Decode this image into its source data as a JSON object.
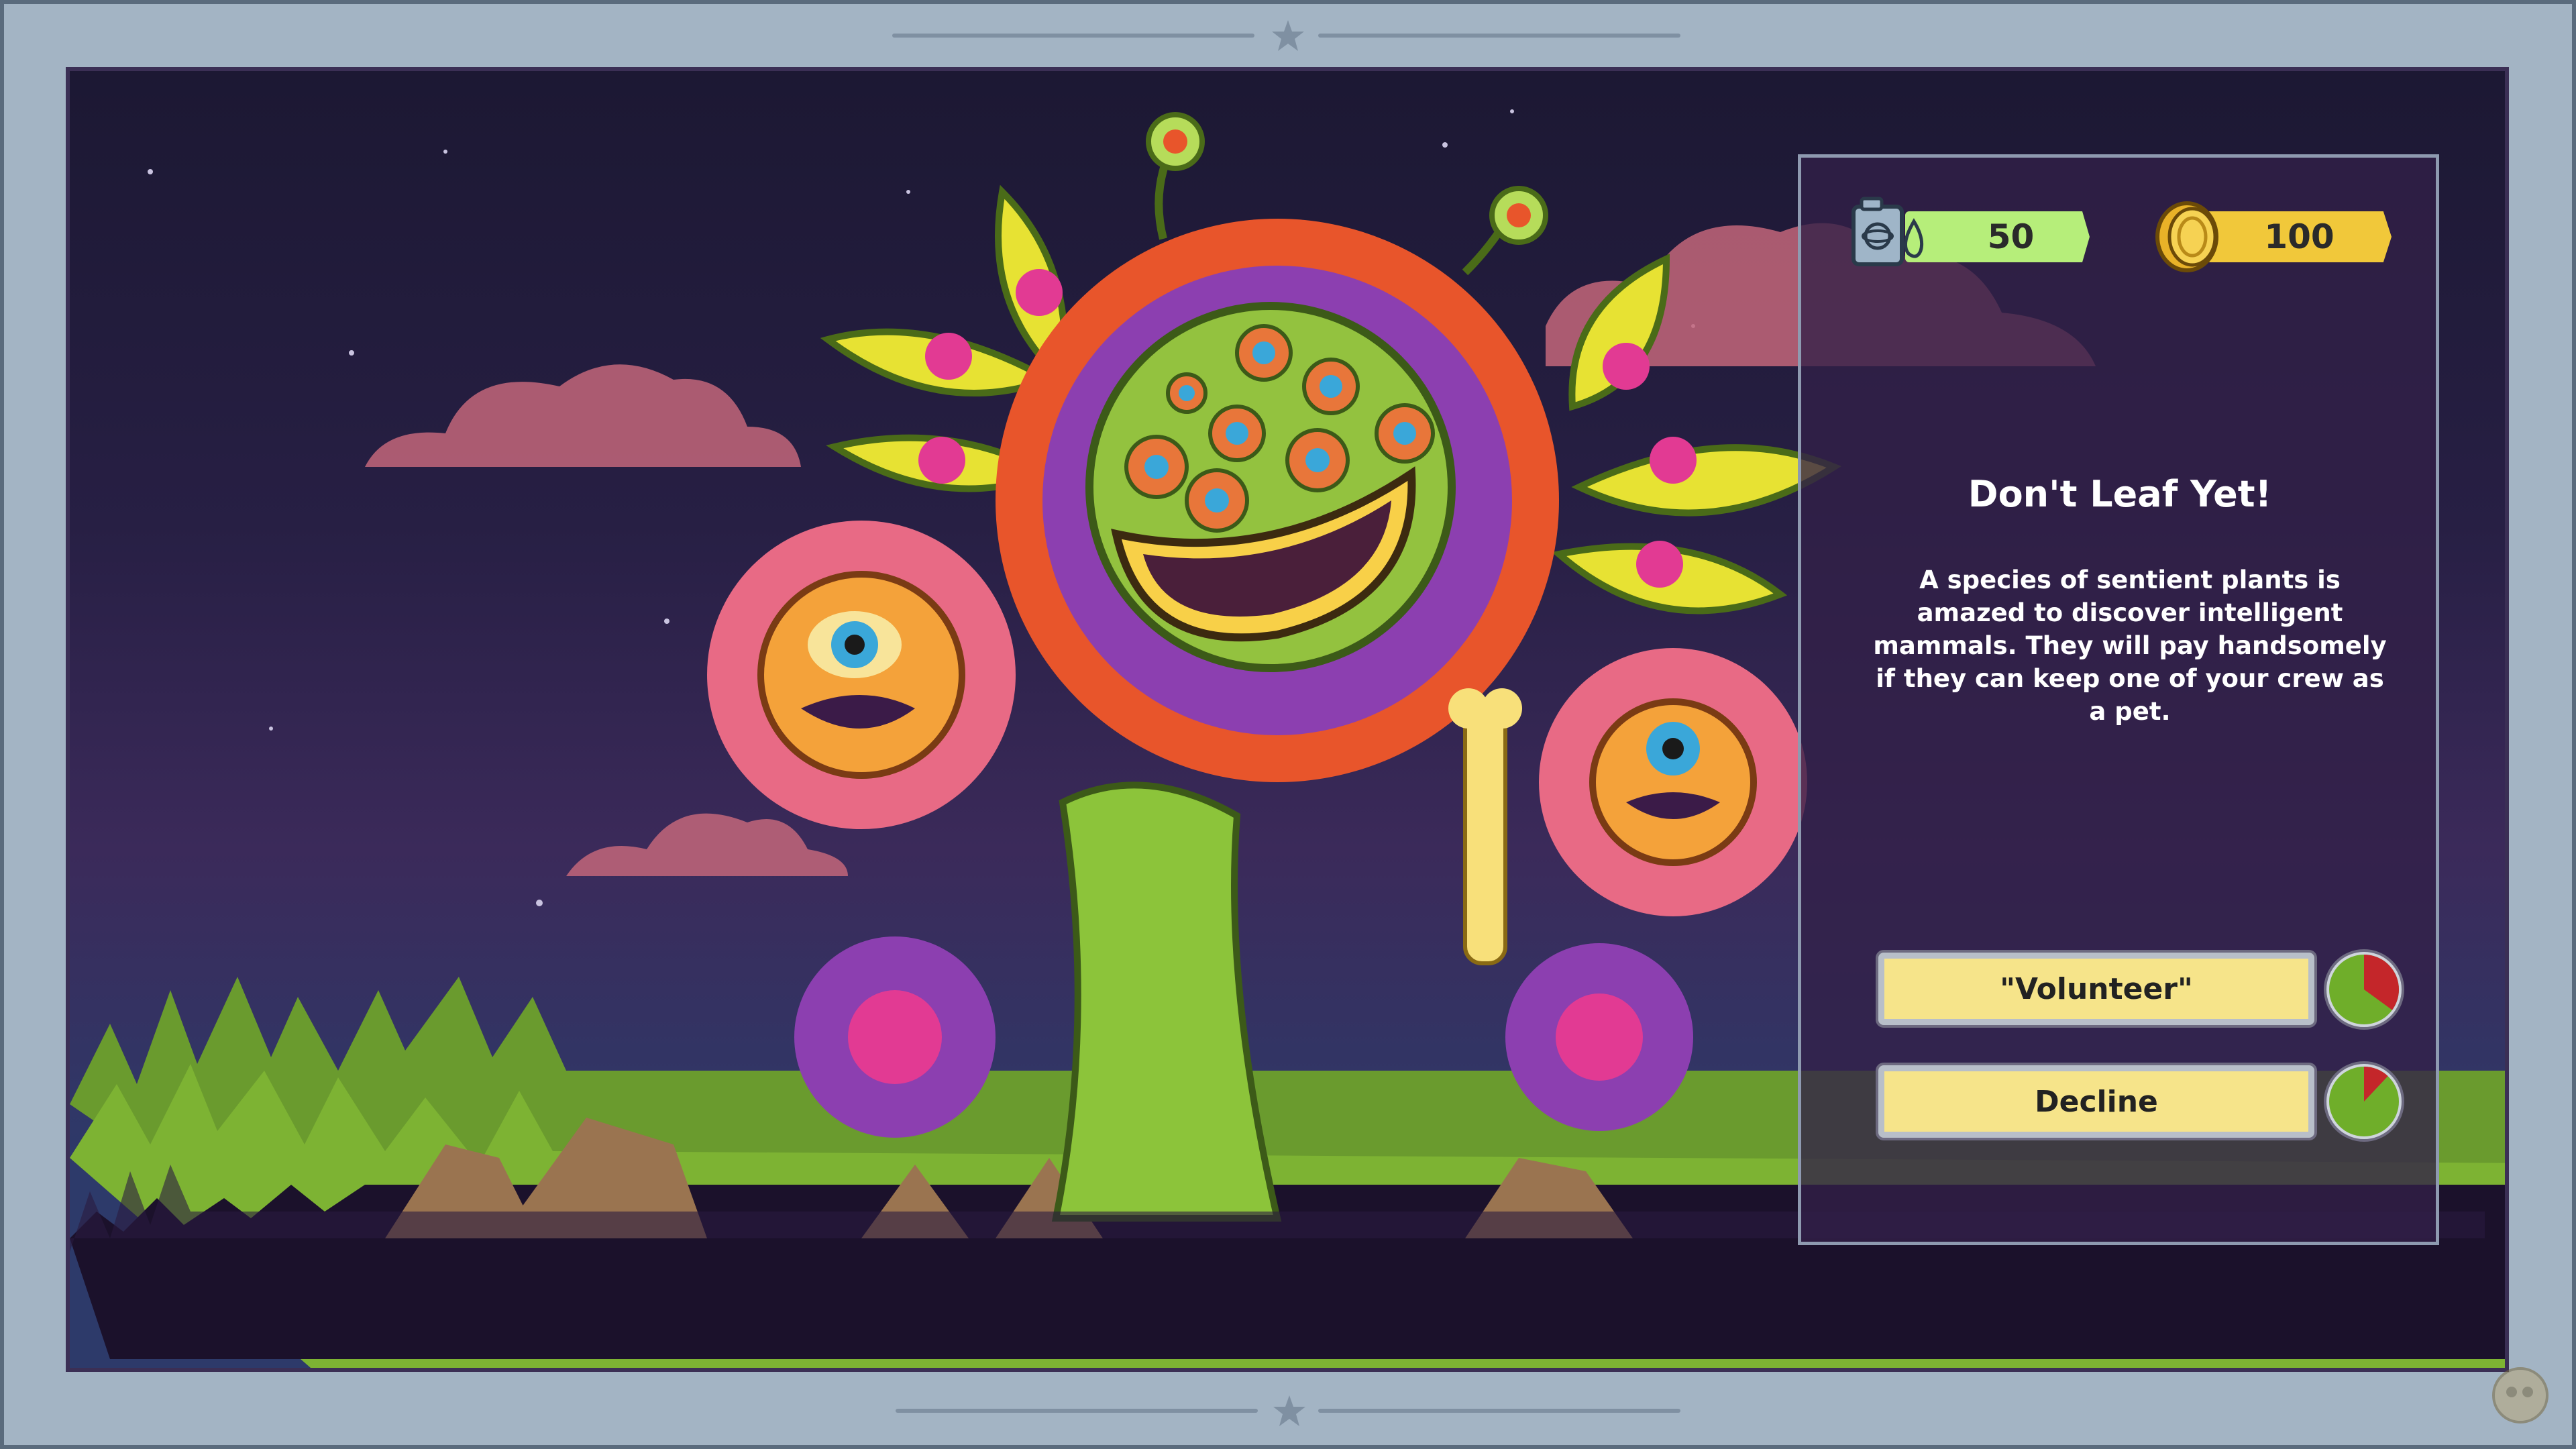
{
  "event": {
    "title": "Don't Leaf Yet!",
    "description": "A species of sentient plants is amazed to discover intelligent mammals. They will pay handsomely if they can keep one of your crew as a pet."
  },
  "resources": {
    "fuel": {
      "value": "50",
      "icon": "fuel-canister-icon",
      "color": "#b6ee7a"
    },
    "coins": {
      "value": "100",
      "icon": "coin-icon",
      "color": "#f1c83a"
    }
  },
  "choices": [
    {
      "label": "\"Volunteer\"",
      "success_fraction": 0.65
    },
    {
      "label": "Decline",
      "success_fraction": 0.88
    }
  ],
  "colors": {
    "panel_bg": "#322048",
    "button_bg": "#f6e48a",
    "chance_success": "#6fae2a",
    "chance_fail": "#c4262a"
  }
}
